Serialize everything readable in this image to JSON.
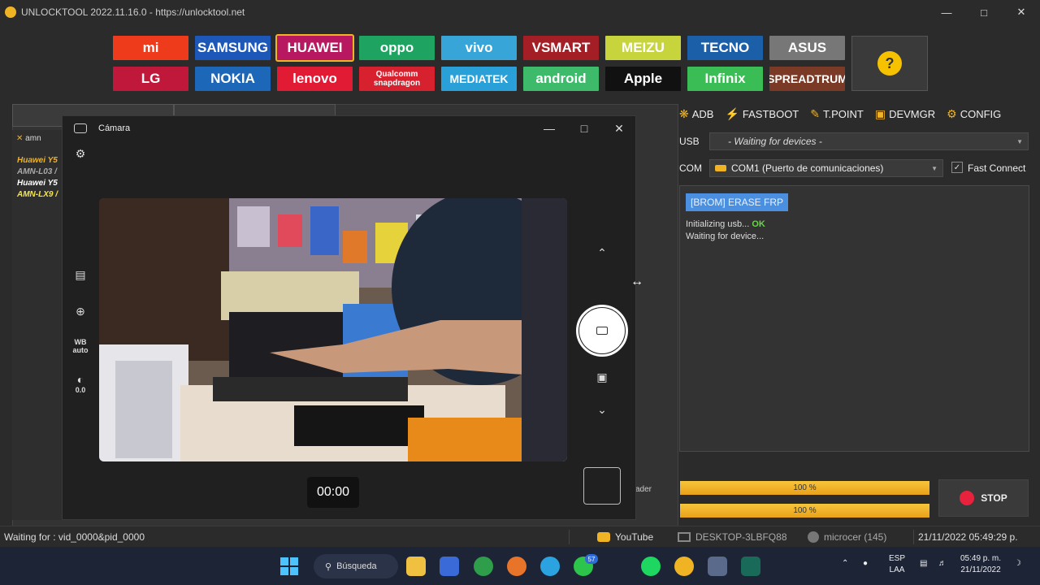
{
  "window": {
    "title": "UNLOCKTOOL 2022.11.16.0 - https://unlocktool.net"
  },
  "brands_row1": [
    {
      "label": "mi",
      "bg": "#ee3b1c",
      "color": "#ffffff"
    },
    {
      "label": "SAMSUNG",
      "bg": "#1d58b8",
      "color": "#ffffff"
    },
    {
      "label": "HUAWEI",
      "bg": "#b8185f",
      "color": "#ffffff"
    },
    {
      "label": "oppo",
      "bg": "#1ea361",
      "color": "#ffffff"
    },
    {
      "label": "vivo",
      "bg": "#37a5d8",
      "color": "#ffffff"
    },
    {
      "label": "VSMART",
      "bg": "#a41f25",
      "color": "#ffffff"
    },
    {
      "label": "MEIZU",
      "bg": "#c8d43c",
      "color": "#ffffff"
    },
    {
      "label": "TECNO",
      "bg": "#1b5fa8",
      "color": "#ffffff"
    },
    {
      "label": "ASUS",
      "bg": "#777777",
      "color": "#ffffff"
    }
  ],
  "brands_row2": [
    {
      "label": "LG",
      "bg": "#c0183a",
      "color": "#ffffff"
    },
    {
      "label": "NOKIA",
      "bg": "#1d67b8",
      "color": "#ffffff"
    },
    {
      "label": "lenovo",
      "bg": "#e01b33",
      "color": "#ffffff"
    },
    {
      "label": "Qualcomm snapdragon",
      "bg": "#d8212f",
      "color": "#ffffff"
    },
    {
      "label": "MEDIATEK",
      "bg": "#2aa0d8",
      "color": "#ffffff"
    },
    {
      "label": "android",
      "bg": "#3dbb6a",
      "color": "#ffffff"
    },
    {
      "label": "Apple",
      "bg": "#111111",
      "color": "#ffffff"
    },
    {
      "label": "Infinix",
      "bg": "#3bbd55",
      "color": "#ffffff"
    },
    {
      "label": "SPREADTRUM",
      "bg": "#7a3a26",
      "color": "#ffffff"
    }
  ],
  "help_symbol": "?",
  "left": {
    "tabs": [
      "",
      ""
    ],
    "search_value": "amn",
    "models": [
      {
        "text": "Huawei Y5",
        "color": "#f0b323"
      },
      {
        "text": "AMN-L03 /",
        "color": "#aaaaaa"
      },
      {
        "text": "Huawei Y5",
        "color": "#ffffff"
      },
      {
        "text": "AMN-LX9 /",
        "color": "#f6e44a"
      }
    ],
    "loader_label": "ader"
  },
  "menu": {
    "items": [
      {
        "label": "ADB",
        "icon": "bug-icon"
      },
      {
        "label": "FASTBOOT",
        "icon": "bolt-icon"
      },
      {
        "label": "T.POINT",
        "icon": "pin-icon"
      },
      {
        "label": "DEVMGR",
        "icon": "device-icon"
      },
      {
        "label": "CONFIG",
        "icon": "gear-icon"
      }
    ]
  },
  "usb": {
    "label": "USB",
    "value": "- Waiting for devices -"
  },
  "com": {
    "label": "COM",
    "value": "COM1 (Puerto de comunicaciones)"
  },
  "fast_connect": {
    "label": "Fast Connect",
    "checked": true
  },
  "log": {
    "badge": "[BROM] ERASE FRP",
    "line1_prefix": "Initializing usb... ",
    "line1_status": "OK",
    "line2": "Waiting for device..."
  },
  "progress": [
    {
      "label": "100 %",
      "value": 1.0
    },
    {
      "label": "100 %",
      "value": 1.0
    }
  ],
  "stop": {
    "label": "STOP"
  },
  "status": {
    "left": "Waiting for : vid_0000&pid_0000",
    "youtube": "YouTube",
    "pc": "DESKTOP-3LBFQ88",
    "user": "microcer (145)",
    "datetime": "21/11/2022 05:49:29 p."
  },
  "camera": {
    "title": "Cámara",
    "wb_label": "WB",
    "wb_value": "auto",
    "exposure_value": "0.0",
    "timer": "00:00"
  },
  "taskbar": {
    "search_label": "Búsqueda",
    "whatsapp_badge": "57",
    "lang_top": "ESP",
    "lang_bottom": "LAA",
    "time": "05:49 p. m.",
    "date": "21/11/2022"
  }
}
